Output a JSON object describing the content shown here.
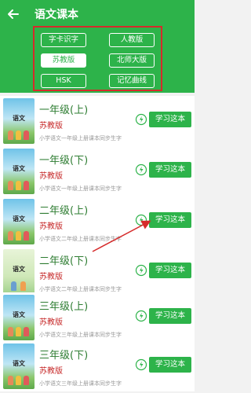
{
  "header": {
    "title": "语文课本"
  },
  "filters": [
    {
      "label": "字卡识字",
      "active": false
    },
    {
      "label": "人教版",
      "active": false
    },
    {
      "label": "苏教版",
      "active": true
    },
    {
      "label": "北师大版",
      "active": false
    },
    {
      "label": "HSK",
      "active": false
    },
    {
      "label": "记忆曲线",
      "active": false
    }
  ],
  "study_label": "学习这本",
  "cover_title": "语文",
  "books": [
    {
      "grade": "一年级(上)",
      "publisher": "苏教版",
      "desc": "小学语文一年级上册课本同步生字"
    },
    {
      "grade": "一年级(下)",
      "publisher": "苏教版",
      "desc": "小学语文一年级上册课本同步生字"
    },
    {
      "grade": "二年级(上)",
      "publisher": "苏教版",
      "desc": "小学语文二年级上册课本同步生字"
    },
    {
      "grade": "二年级(下)",
      "publisher": "苏教版",
      "desc": "小学语文二年级上册课本同步生字"
    },
    {
      "grade": "三年级(上)",
      "publisher": "苏教版",
      "desc": "小学语文三年级上册课本同步生字"
    },
    {
      "grade": "三年级(下)",
      "publisher": "苏教版",
      "desc": "小学语文三年级上册课本同步生字"
    }
  ],
  "colors": {
    "brand": "#2db34a",
    "annotation": "#d62b2b",
    "publisher": "#c62828"
  }
}
